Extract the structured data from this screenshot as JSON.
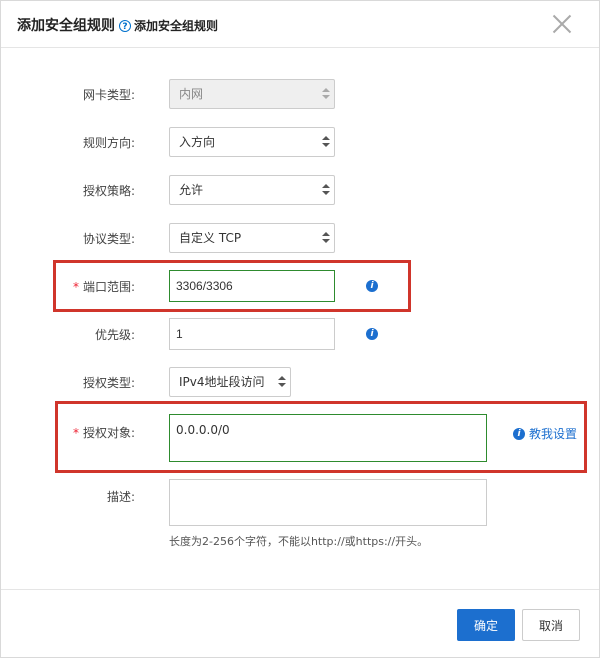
{
  "dialog": {
    "title": "添加安全组规则",
    "help_icon": "?",
    "help_text": "添加安全组规则",
    "close_icon": "close-icon"
  },
  "form": {
    "nic_type": {
      "label": "网卡类型:",
      "value": "内网",
      "disabled": true
    },
    "direction": {
      "label": "规则方向:",
      "value": "入方向"
    },
    "policy": {
      "label": "授权策略:",
      "value": "允许"
    },
    "protocol": {
      "label": "协议类型:",
      "value": "自定义 TCP"
    },
    "port_range": {
      "required_mark": "*",
      "label": "端口范围:",
      "value": "3306/3306"
    },
    "priority": {
      "label": "优先级:",
      "value": "1"
    },
    "auth_type": {
      "label": "授权类型:",
      "value": "IPv4地址段访问"
    },
    "auth_object": {
      "required_mark": "*",
      "label": "授权对象:",
      "value": "0.0.0.0/0",
      "teach_link": "教我设置"
    },
    "description": {
      "label": "描述:",
      "value": "",
      "hint": "长度为2-256个字符，不能以http://或https://开头。"
    }
  },
  "info_icon_glyph": "i",
  "footer": {
    "ok_label": "确定",
    "cancel_label": "取消"
  },
  "colors": {
    "primary": "#1c6fcf",
    "highlight": "#d0352b",
    "valid_border": "#2e8b2e"
  }
}
